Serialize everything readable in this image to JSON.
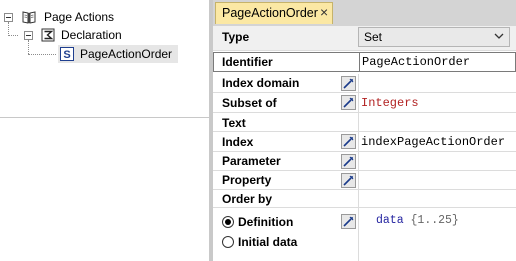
{
  "tree": {
    "items": [
      {
        "label": "Page Actions",
        "icon": "book-icon"
      },
      {
        "label": "Declaration",
        "icon": "declaration-icon"
      },
      {
        "label": "PageActionOrder",
        "icon": "set-icon"
      }
    ]
  },
  "tab": {
    "title": "PageActionOrder",
    "close": "×"
  },
  "form": {
    "type": {
      "label": "Type",
      "value": "Set"
    },
    "identifier": {
      "label": "Identifier",
      "value": "PageActionOrder"
    },
    "index_domain": {
      "label": "Index domain",
      "value": ""
    },
    "subset_of": {
      "label": "Subset of",
      "value": "Integers"
    },
    "text": {
      "label": "Text",
      "value": ""
    },
    "index": {
      "label": "Index",
      "value": "indexPageActionOrder"
    },
    "parameter": {
      "label": "Parameter",
      "value": ""
    },
    "property": {
      "label": "Property",
      "value": ""
    },
    "order_by": {
      "label": "Order by",
      "value": ""
    },
    "definition": {
      "label": "Definition",
      "selected": true,
      "keyword": "data",
      "range": "{1..25}"
    },
    "initial_data": {
      "label": "Initial data",
      "selected": false
    }
  },
  "colors": {
    "tab": "#fbe8a4",
    "subset_value": "#b22222",
    "keyword": "#2323a0"
  }
}
